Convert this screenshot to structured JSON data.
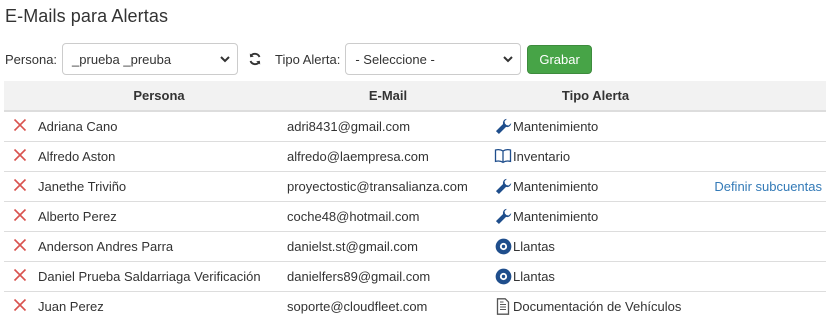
{
  "title": "E-Mails para Alertas",
  "toolbar": {
    "persona_label": "Persona:",
    "persona_value": "_prueba _preuba",
    "tipo_label": "Tipo Alerta:",
    "tipo_value": "- Seleccione -",
    "save_label": "Grabar"
  },
  "table": {
    "headers": {
      "persona": "Persona",
      "email": "E-Mail",
      "tipo": "Tipo Alerta"
    },
    "rows": [
      {
        "name": "Adriana Cano",
        "email": "adri8431@gmail.com",
        "type": "Mantenimiento",
        "icon": "wrench-icon",
        "link": ""
      },
      {
        "name": "Alfredo Aston",
        "email": "alfredo@laempresa.com",
        "type": "Inventario",
        "icon": "book-icon",
        "link": ""
      },
      {
        "name": "Janethe Triviño",
        "email": "proyectostic@transalianza.com",
        "type": "Mantenimiento",
        "icon": "wrench-icon",
        "link": "Definir subcuentas"
      },
      {
        "name": "Alberto Perez",
        "email": "coche48@hotmail.com",
        "type": "Mantenimiento",
        "icon": "wrench-icon",
        "link": ""
      },
      {
        "name": "Anderson Andres Parra",
        "email": "danielst.st@gmail.com",
        "type": "Llantas",
        "icon": "tire-icon",
        "link": ""
      },
      {
        "name": "Daniel Prueba Saldarriaga Verificación",
        "email": "danielfers89@gmail.com",
        "type": "Llantas",
        "icon": "tire-icon",
        "link": ""
      },
      {
        "name": "Juan Perez",
        "email": "soporte@cloudfleet.com",
        "type": "Documentación de Vehículos",
        "icon": "document-icon",
        "link": ""
      }
    ]
  },
  "colors": {
    "delete": "#d9534f",
    "save_button": "#47a447",
    "link": "#337ab7",
    "icon_blue": "#1f4e8c",
    "header_bg": "#f2f2f2"
  }
}
